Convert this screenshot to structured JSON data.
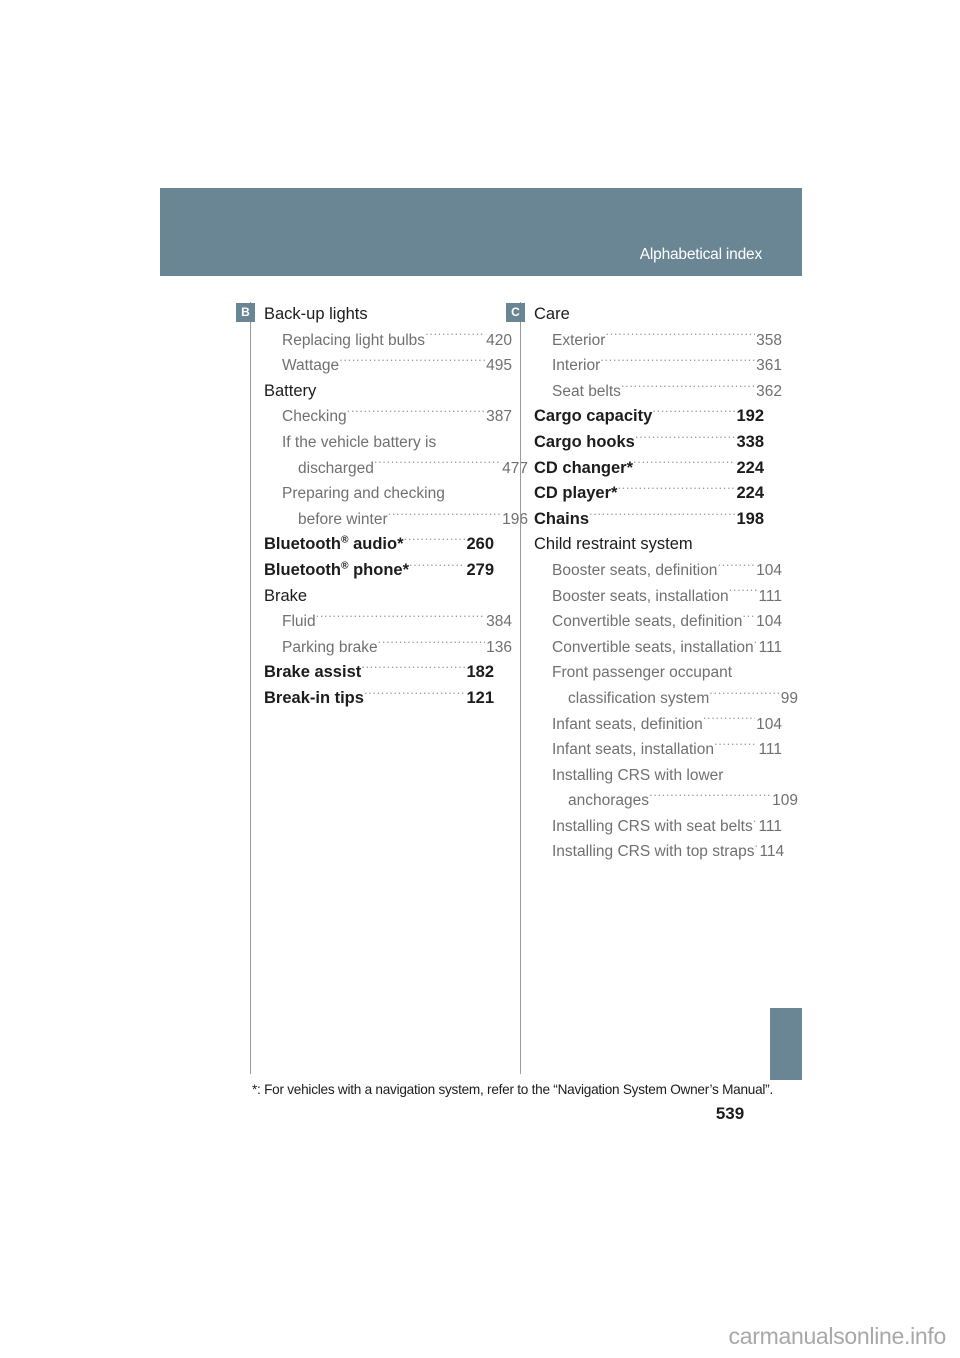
{
  "page": {
    "header_title": "Alphabetical index",
    "folio": "539",
    "footnote": "*: For vehicles with a navigation system, refer to the “Navigation System Owner’s Manual”.",
    "watermark": "carmanualsonline.info",
    "accent_color": "#6a8694",
    "text_color": "#1c1c1c",
    "subentry_color": "#707070"
  },
  "columns": [
    {
      "letter": "B",
      "entries": [
        {
          "level": 0,
          "label": "Back-up lights",
          "page": ""
        },
        {
          "level": 1,
          "label": "Replacing light bulbs",
          "page": "420"
        },
        {
          "level": 1,
          "label": "Wattage",
          "page": "495"
        },
        {
          "level": 0,
          "label": "Battery",
          "page": ""
        },
        {
          "level": 1,
          "label": "Checking",
          "page": "387"
        },
        {
          "level": 1,
          "label": "If the vehicle battery is",
          "page": ""
        },
        {
          "level": 2,
          "label": "discharged",
          "page": "477"
        },
        {
          "level": 1,
          "label": "Preparing and checking",
          "page": ""
        },
        {
          "level": 2,
          "label": "before winter",
          "page": "196"
        },
        {
          "level": 0,
          "label": "Bluetooth® audio*",
          "label_base": "Bluetooth",
          "label_sup": "®",
          "label_tail": " audio*",
          "page": "260"
        },
        {
          "level": 0,
          "label": "Bluetooth® phone*",
          "label_base": "Bluetooth",
          "label_sup": "®",
          "label_tail": " phone*",
          "page": "279"
        },
        {
          "level": 0,
          "label": "Brake",
          "page": ""
        },
        {
          "level": 1,
          "label": "Fluid",
          "page": "384"
        },
        {
          "level": 1,
          "label": "Parking brake",
          "page": "136"
        },
        {
          "level": 0,
          "label": "Brake assist",
          "page": "182"
        },
        {
          "level": 0,
          "label": "Break-in tips",
          "page": "121"
        }
      ]
    },
    {
      "letter": "C",
      "entries": [
        {
          "level": 0,
          "label": "Care",
          "page": ""
        },
        {
          "level": 1,
          "label": "Exterior",
          "page": "358"
        },
        {
          "level": 1,
          "label": "Interior",
          "page": "361"
        },
        {
          "level": 1,
          "label": "Seat belts",
          "page": "362"
        },
        {
          "level": 0,
          "label": "Cargo capacity",
          "page": "192"
        },
        {
          "level": 0,
          "label": "Cargo hooks",
          "page": "338"
        },
        {
          "level": 0,
          "label": "CD changer*",
          "page": "224"
        },
        {
          "level": 0,
          "label": "CD player*",
          "page": "224"
        },
        {
          "level": 0,
          "label": "Chains",
          "page": "198"
        },
        {
          "level": 0,
          "label": "Child restraint system",
          "page": ""
        },
        {
          "level": 1,
          "label": "Booster seats, definition",
          "page": "104"
        },
        {
          "level": 1,
          "label": "Booster seats, installation",
          "page": "111"
        },
        {
          "level": 1,
          "label": "Convertible seats, definition",
          "page": "104"
        },
        {
          "level": 1,
          "label": "Convertible seats, installation",
          "page": "111"
        },
        {
          "level": 1,
          "label": "Front passenger occupant",
          "page": ""
        },
        {
          "level": 2,
          "label": "classification system",
          "page": "99"
        },
        {
          "level": 1,
          "label": "Infant seats, definition",
          "page": "104"
        },
        {
          "level": 1,
          "label": "Infant seats, installation",
          "page": "111"
        },
        {
          "level": 1,
          "label": "Installing CRS with lower",
          "page": ""
        },
        {
          "level": 2,
          "label": "anchorages",
          "page": "109"
        },
        {
          "level": 1,
          "label": "Installing CRS with seat belts",
          "page": "111"
        },
        {
          "level": 1,
          "label": "Installing CRS with top straps",
          "page": "114"
        }
      ]
    }
  ]
}
